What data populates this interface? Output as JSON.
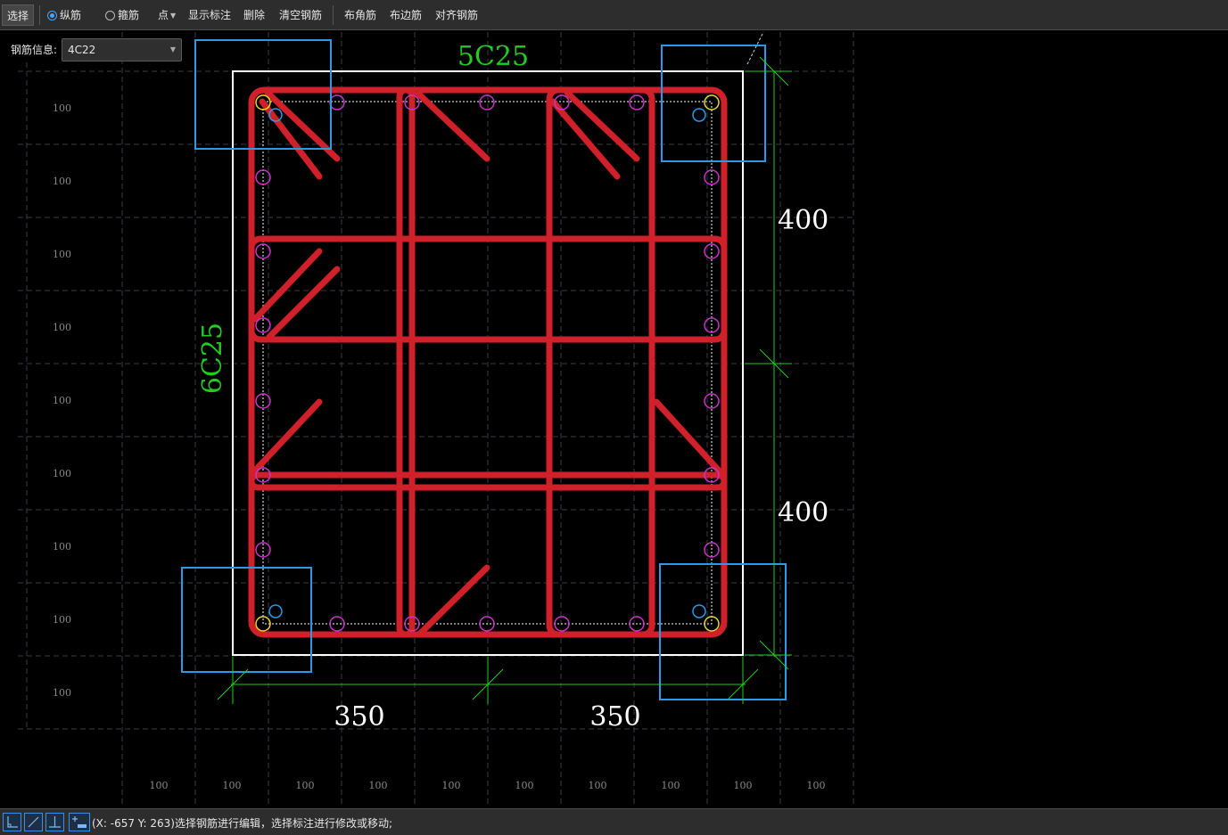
{
  "toolbar": {
    "select": "选择",
    "longitudinal": "纵筋",
    "stirrup": "箍筋",
    "point": "点",
    "show_annotation": "显示标注",
    "delete": "删除",
    "clear_rebar": "清空钢筋",
    "corner_rebar": "布角筋",
    "edge_rebar": "布边筋",
    "align_rebar": "对齐钢筋"
  },
  "rebar_info": {
    "label": "钢筋信息:",
    "value": "4C22"
  },
  "drawing": {
    "top_rebar_label": "5C25",
    "side_rebar_label": "6C25",
    "dim_right_upper": "400",
    "dim_right_lower": "400",
    "dim_bottom_left": "350",
    "dim_bottom_right": "350",
    "grid_spacing_label": "100"
  },
  "status": {
    "message": "(X: -657 Y: 263)选择钢筋进行编辑，选择标注进行修改或移动;"
  },
  "colors": {
    "stirrup": "#d0202a",
    "longitudinal_rebar": "#cc33cc",
    "corner_rebar": "#e8d830",
    "selection_box": "#2a9ae8",
    "dimension": "#22cc22",
    "outline": "#ffffff"
  }
}
